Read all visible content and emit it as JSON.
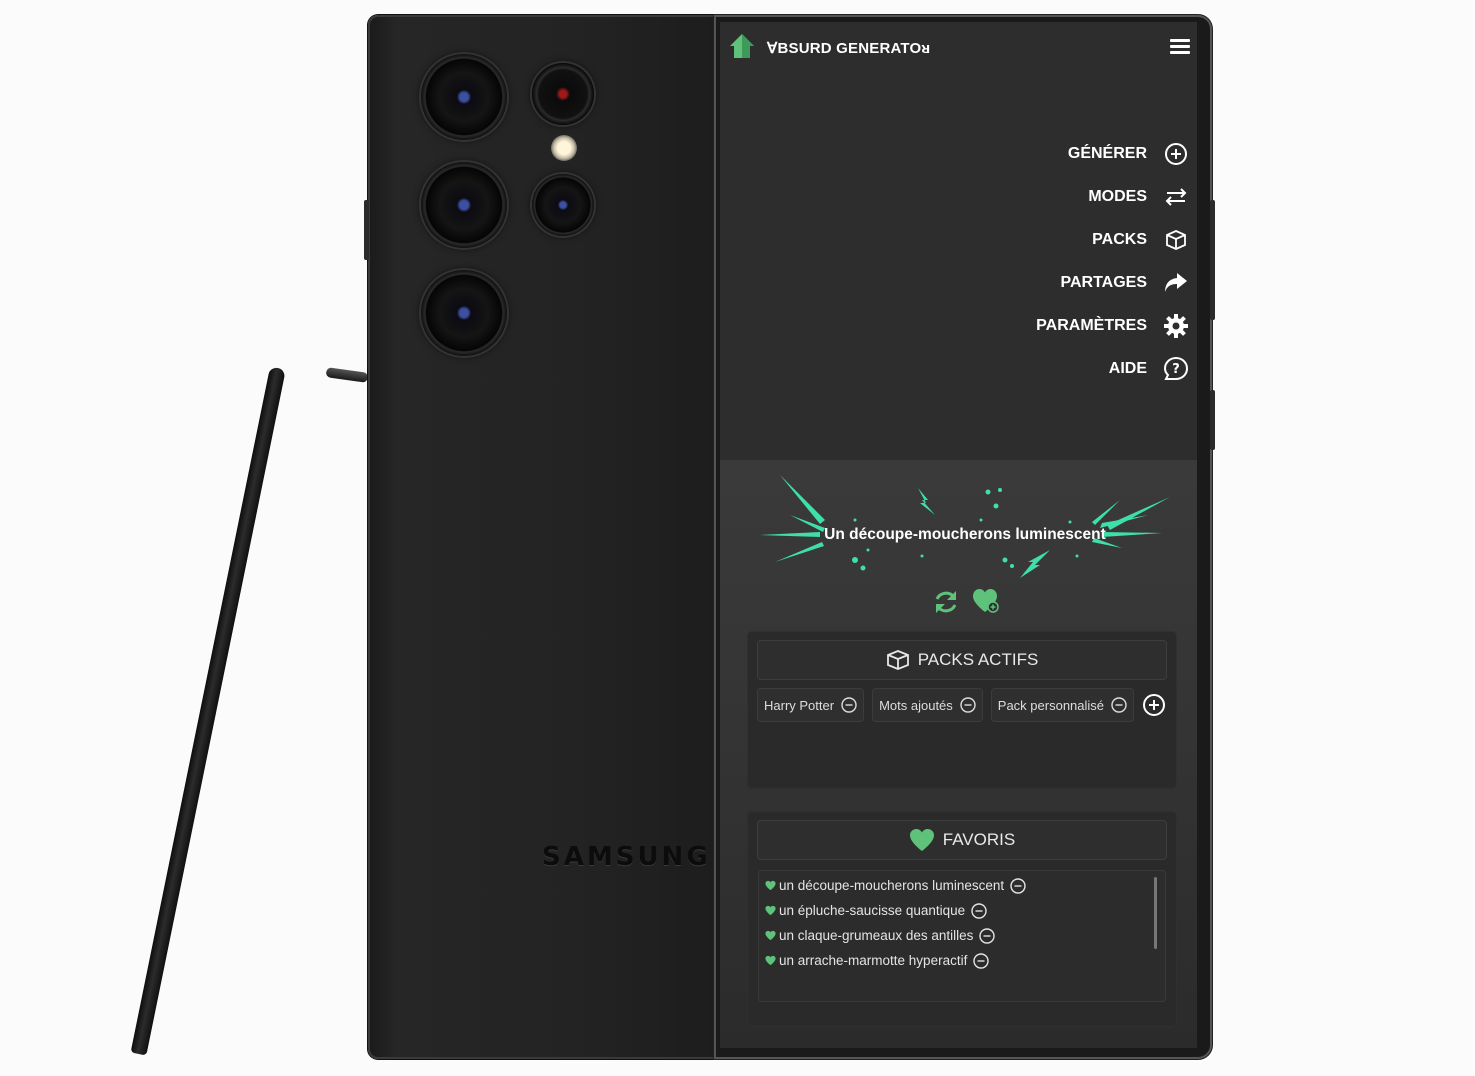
{
  "device": {
    "brand": "SAMSUNG"
  },
  "app": {
    "title": "∀BSURD GENERATOᴚ"
  },
  "menu": [
    {
      "label": "GÉNÉRER",
      "icon": "plus-circle-icon"
    },
    {
      "label": "MODES",
      "icon": "swap-arrows-icon"
    },
    {
      "label": "PACKS",
      "icon": "box-icon"
    },
    {
      "label": "PARTAGES",
      "icon": "share-arrow-icon"
    },
    {
      "label": "PARAMÈTRES",
      "icon": "gear-icon"
    },
    {
      "label": "AIDE",
      "icon": "help-bubble-icon"
    }
  ],
  "result": {
    "text": "Un découpe-moucherons luminescent",
    "refresh_icon": "refresh-icon",
    "favorite_icon": "heart-add-icon"
  },
  "packs": {
    "title": "PACKS ACTIFS",
    "items": [
      "Harry Potter",
      "Mots ajoutés",
      "Pack personnalisé"
    ]
  },
  "favorites": {
    "title": "FAVORIS",
    "items": [
      "un découpe-moucherons luminescent",
      "un épluche-saucisse quantique",
      "un claque-grumeaux des antilles",
      "un arrache-marmotte hyperactif"
    ]
  },
  "colors": {
    "accent": "#5ec27a",
    "burst": "#3ee0a8",
    "screen_bg": "#2b2b2b"
  }
}
